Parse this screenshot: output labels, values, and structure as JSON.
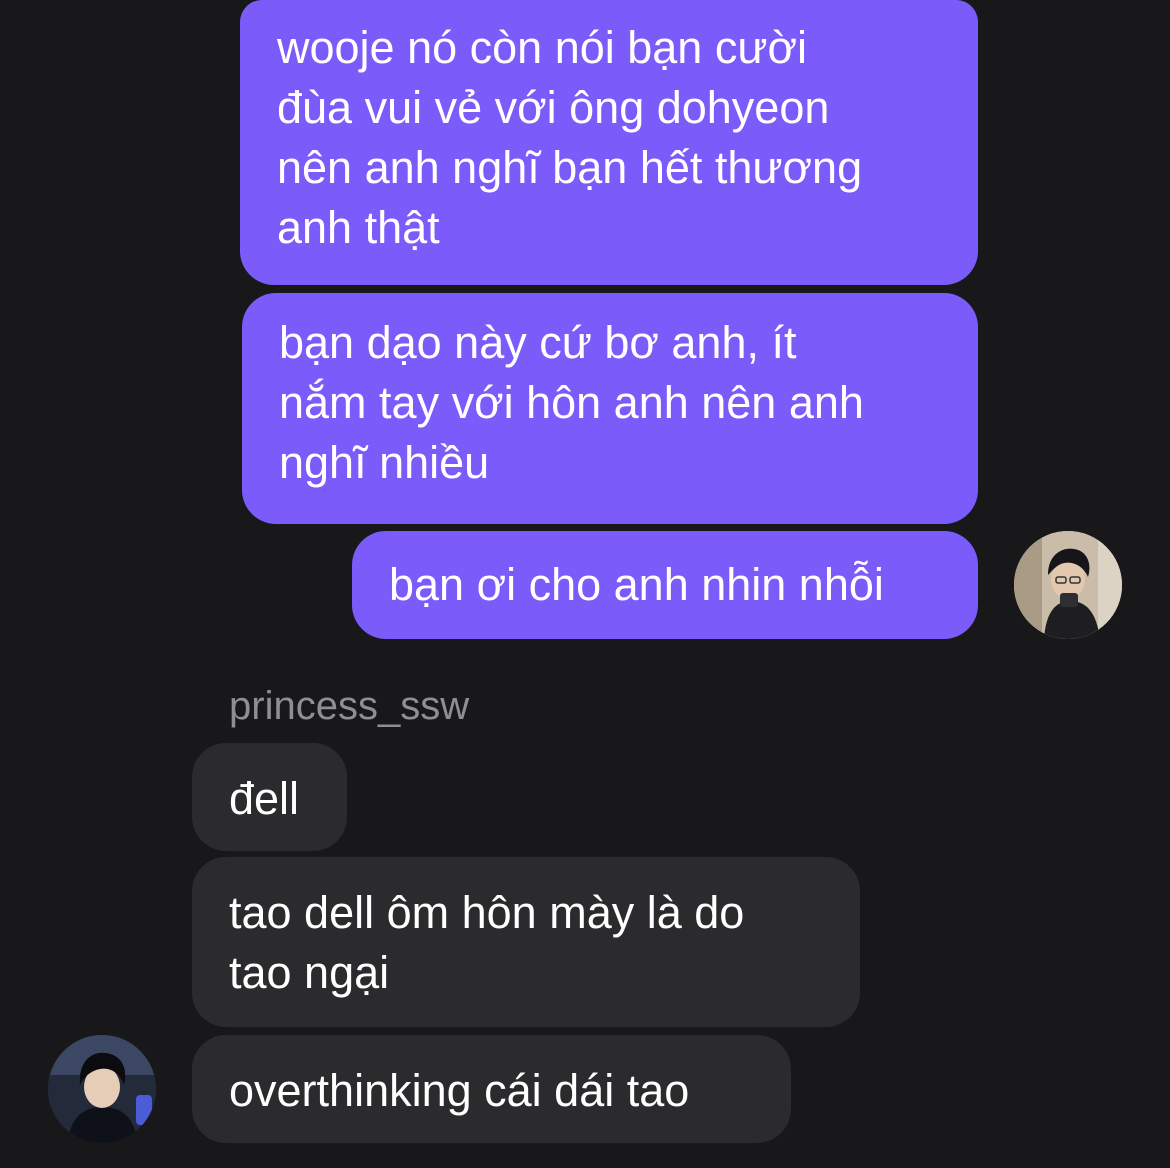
{
  "messages": {
    "outgoing": [
      "wooje nó còn nói bạn cười\nđùa vui vẻ với ông dohyeon\nnên anh nghĩ bạn hết thương\nanh thật",
      "bạn dạo này cứ bơ anh, ít\nnắm tay với hôn anh nên anh\nnghĩ nhiều",
      "bạn ơi cho anh nhin nhỗi"
    ],
    "sender_name": "princess_ssw",
    "incoming": [
      "đell",
      "tao dell ôm hôn mày là do\ntao ngại",
      "overthinking cái dái tao"
    ]
  },
  "avatars": {
    "me": "avatar-photo",
    "other": "avatar-photo"
  },
  "colors": {
    "background": "#18181b",
    "outgoing_bubble": "#7b5cfa",
    "incoming_bubble": "#2b2b2e",
    "sender_name": "#8e8e93",
    "text": "#ffffff"
  }
}
